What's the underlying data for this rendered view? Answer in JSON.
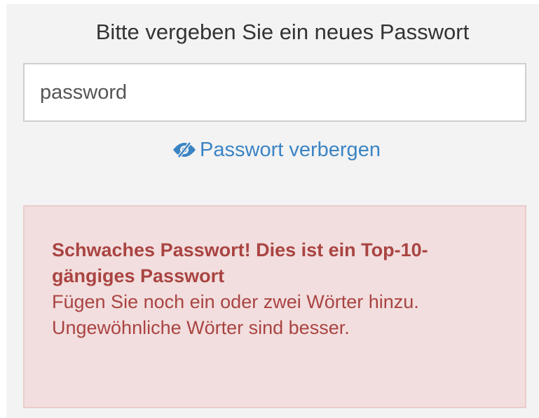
{
  "form": {
    "heading": "Bitte vergeben Sie ein neues Passwort",
    "password_value": "password"
  },
  "toggle": {
    "label": "Passwort verbergen",
    "icon": "eye-slash-icon"
  },
  "alert": {
    "title": "Schwaches Passwort! Dies ist ein Top-10-gängiges Passwort",
    "hint": "Fügen Sie noch ein oder zwei Wörter hinzu. Ungewöhnliche Wörter sind besser."
  },
  "colors": {
    "panel_background": "#f3f3f3",
    "link": "#3b84c4",
    "alert_background": "#f2dede",
    "alert_text": "#a94442"
  }
}
